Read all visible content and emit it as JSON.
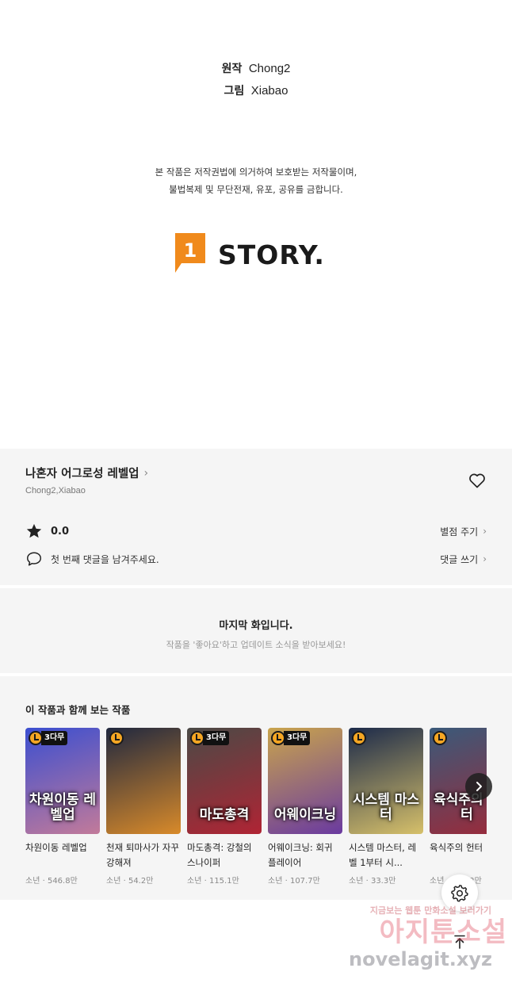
{
  "credits": {
    "original_label": "원작",
    "original_name": "Chong2",
    "art_label": "그림",
    "art_name": "Xiabao"
  },
  "copyright": {
    "line1": "본 작품은 저작권법에 의거하여 보호받는 저작물이며,",
    "line2": "불법복제 및 무단전재, 유포, 공유를 금합니다."
  },
  "logo": {
    "number": "1",
    "text": "STORY."
  },
  "series": {
    "title": "나혼자 어그로성 레벨업",
    "authors": "Chong2,Xiabao",
    "rating": "0.0",
    "rate_link": "별점 주기",
    "comment_prompt": "첫 번째 댓글을 남겨주세요.",
    "comment_link": "댓글 쓰기"
  },
  "last_episode": {
    "title": "마지막 화입니다.",
    "subtitle": "작품을 '좋아요'하고 업데이트 소식을 받아보세요!"
  },
  "recommendations": {
    "heading": "이 작품과 함께 보는 작품",
    "items": [
      {
        "title": "차원이동 레벨업",
        "genre": "소년",
        "views": "546.8만",
        "badge": "3다무",
        "cover_text": "차원이동 레벨업",
        "colors": [
          "#3b4fd0",
          "#c27a9a"
        ]
      },
      {
        "title": "천재 퇴마사가 자꾸 강해져",
        "genre": "소년",
        "views": "54.2만",
        "badge": "",
        "cover_text": "",
        "colors": [
          "#20283f",
          "#d88a2a"
        ]
      },
      {
        "title": "마도총격: 강철의 스나이퍼",
        "genre": "소년",
        "views": "115.1만",
        "badge": "3다무",
        "cover_text": "마도총격",
        "colors": [
          "#4a4a46",
          "#b02434"
        ]
      },
      {
        "title": "어웨이크닝: 회귀 플레이어",
        "genre": "소년",
        "views": "107.7만",
        "badge": "3다무",
        "cover_text": "어웨이크닝",
        "colors": [
          "#c9a44c",
          "#6a3aa0"
        ]
      },
      {
        "title": "시스템 마스터, 레벨 1부터 시...",
        "genre": "소년",
        "views": "33.3만",
        "badge": "",
        "cover_text": "시스템 마스터",
        "colors": [
          "#1c2a4a",
          "#d6c06a"
        ]
      },
      {
        "title": "육식주의 헌터",
        "genre": "소년",
        "views": "251.2만",
        "badge": "",
        "cover_text": "육식주의 헌터",
        "colors": [
          "#3a5a7a",
          "#9a2a3a"
        ]
      }
    ]
  },
  "watermark": {
    "line1": "지금보는 웹툰 만화소설 보러가기",
    "line2": "아지툰소설",
    "line3": "novelagit.xyz"
  }
}
